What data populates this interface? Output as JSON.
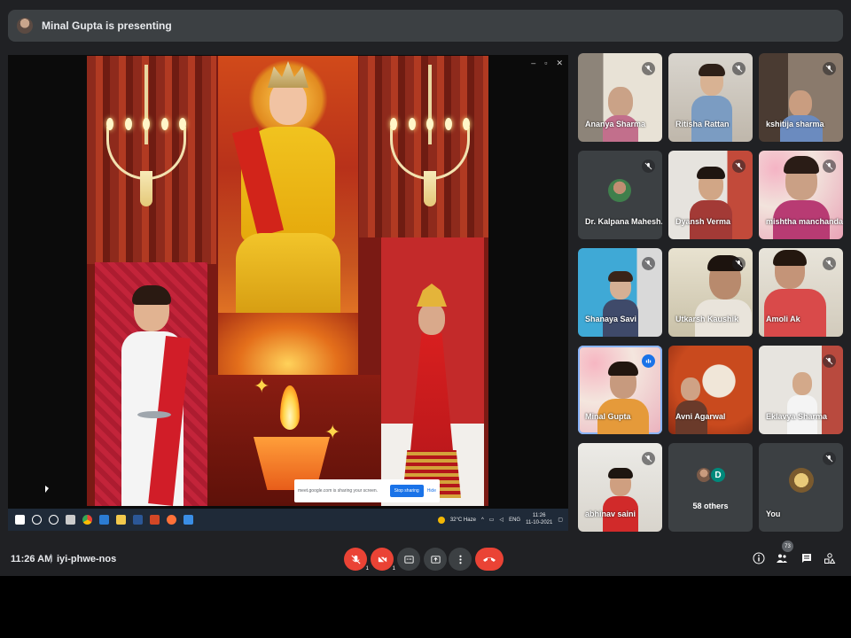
{
  "presenting": {
    "text": "Minal Gupta is presenting"
  },
  "share_popup": {
    "message": "meet.google.com is sharing your screen.",
    "stop_label": "Stop sharing",
    "hide_label": "Hide"
  },
  "taskbar": {
    "weather": "32°C Haze",
    "lang": "ENG",
    "time": "11:26",
    "date": "11-10-2021"
  },
  "tiles": [
    {
      "name": "Ananya Sharma"
    },
    {
      "name": "Ritisha Rattan"
    },
    {
      "name": "kshitija sharma"
    },
    {
      "name": "Dr. Kalpana Mahesh..."
    },
    {
      "name": "Dyansh Verma"
    },
    {
      "name": "mishtha manchanda"
    },
    {
      "name": "Shanaya Savi"
    },
    {
      "name": "Utkarsh Kaushik"
    },
    {
      "name": "Amoli Ak"
    },
    {
      "name": "Minal Gupta"
    },
    {
      "name": "Avni Agarwal"
    },
    {
      "name": "Eklavya Sharma"
    },
    {
      "name": "abhinav saini"
    },
    {
      "name": "58 others",
      "avatar_letter": "D"
    },
    {
      "name": "You"
    }
  ],
  "meeting": {
    "time": "11:26 AM",
    "separator": "|",
    "code": "iyi-phwe-nos"
  },
  "controls": {
    "mic_badge": "1",
    "cam_badge": "1",
    "people_count": "73"
  },
  "colors": {
    "accent_red": "#ea4335",
    "bg": "#202124",
    "tile_bg": "#3c4043",
    "speaking": "#8ab4f8"
  }
}
